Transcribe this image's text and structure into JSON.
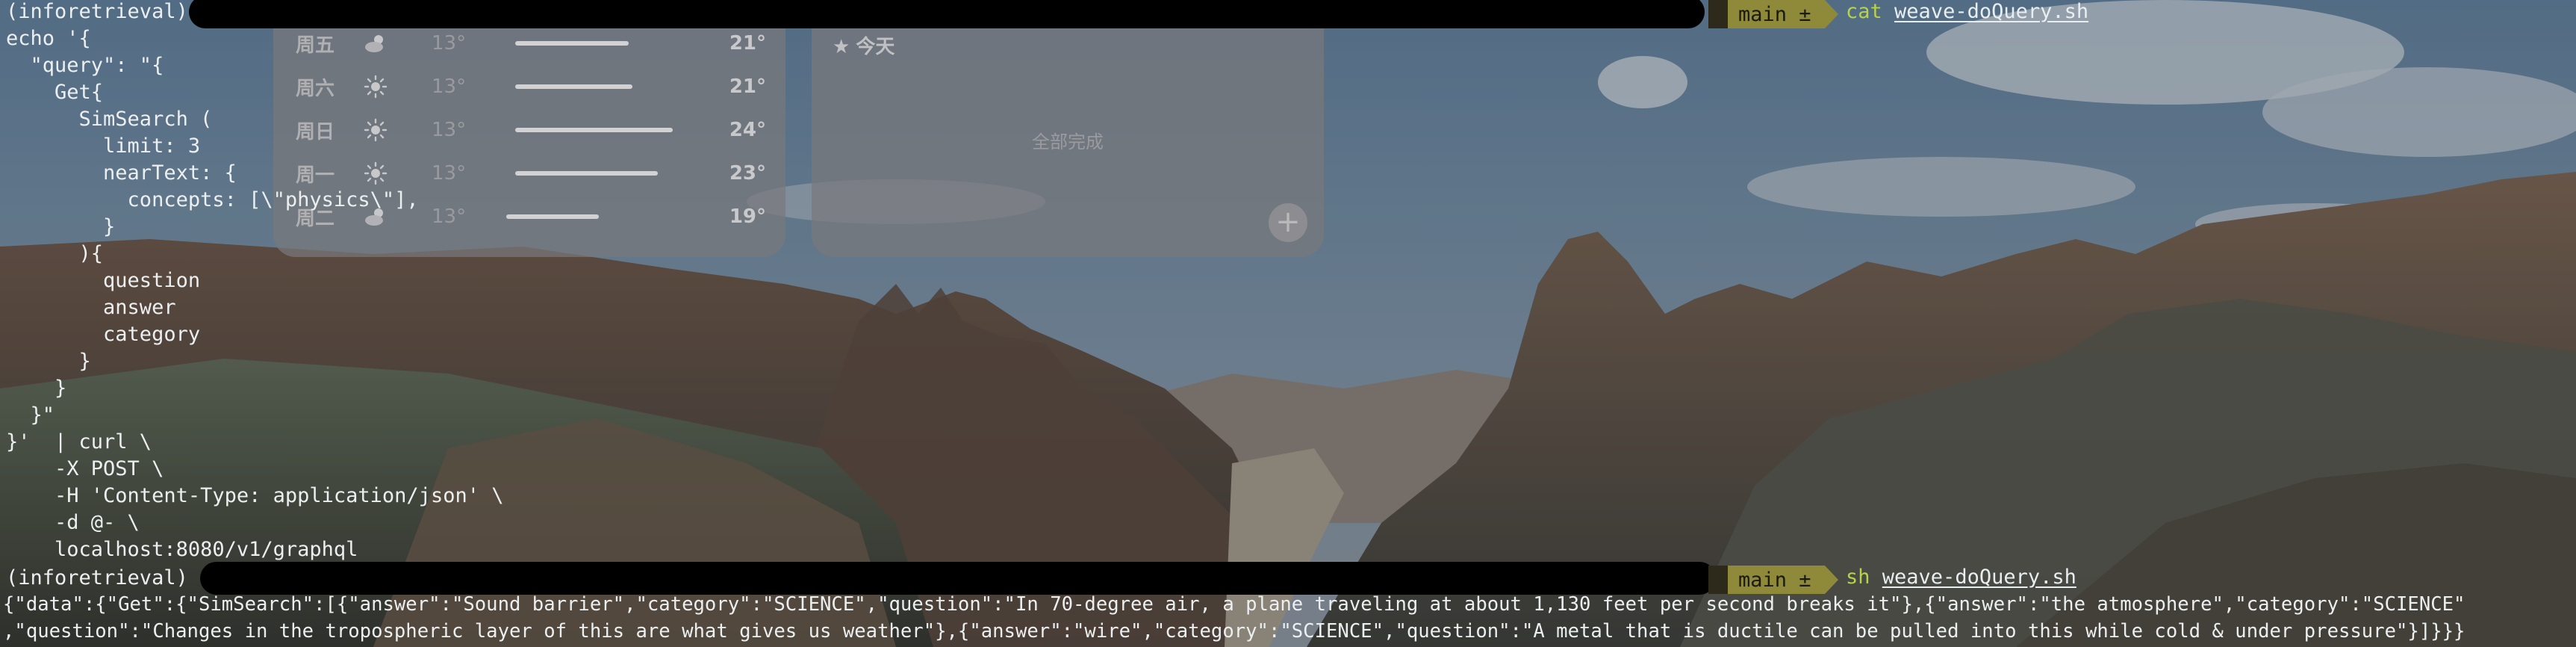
{
  "terminal": {
    "prompt_env": "(inforetrieval)",
    "branch": "main ±",
    "first_command": {
      "name": "cat",
      "arg": "weave-doQuery.sh"
    },
    "file_lines": [
      "echo '{",
      "  \"query\": \"{",
      "    Get{",
      "      SimSearch (",
      "        limit: 3",
      "        nearText: {",
      "          concepts: [\\\"physics\\\"],",
      "        }",
      "      ){",
      "        question",
      "        answer",
      "        category",
      "      }",
      "    }",
      "  }\"",
      "}'  | curl \\",
      "    -X POST \\",
      "    -H 'Content-Type: application/json' \\",
      "    -d @- \\",
      "    localhost:8080/v1/graphql"
    ],
    "second_command": {
      "name": "sh",
      "arg": "weave-doQuery.sh"
    },
    "output_lines": [
      "{\"data\":{\"Get\":{\"SimSearch\":[{\"answer\":\"Sound barrier\",\"category\":\"SCIENCE\",\"question\":\"In 70-degree air, a plane traveling at about 1,130 feet per second breaks it\"},{\"answer\":\"the atmosphere\",\"category\":\"SCIENCE\"",
      ",\"question\":\"Changes in the tropospheric layer of this are what gives us weather\"},{\"answer\":\"wire\",\"category\":\"SCIENCE\",\"question\":\"A metal that is ductile can be pulled into this while cold & under pressure\"}]}}}"
    ]
  },
  "weather_widget": {
    "rows": [
      {
        "day": "周五",
        "icon": "partly-cloudy-icon",
        "low": "13°",
        "high": "21°",
        "bar_start": 0.05,
        "bar_end": 0.66
      },
      {
        "day": "周六",
        "icon": "sun-icon",
        "low": "13°",
        "high": "21°",
        "bar_start": 0.05,
        "bar_end": 0.68
      },
      {
        "day": "周日",
        "icon": "sun-icon",
        "low": "13°",
        "high": "24°",
        "bar_start": 0.05,
        "bar_end": 0.9
      },
      {
        "day": "周一",
        "icon": "sun-icon",
        "low": "13°",
        "high": "23°",
        "bar_start": 0.05,
        "bar_end": 0.82
      },
      {
        "day": "周二",
        "icon": "partly-cloudy-icon",
        "low": "13°",
        "high": "19°",
        "bar_start": 0.0,
        "bar_end": 0.5
      }
    ]
  },
  "reminders_widget": {
    "title": "今天",
    "empty_text": "全部完成",
    "add_symbol": "+"
  },
  "colors": {
    "branch_segment": "#8e8a3a",
    "command_keyword": "#b7d34a",
    "terminal_text": "#eceff0"
  }
}
